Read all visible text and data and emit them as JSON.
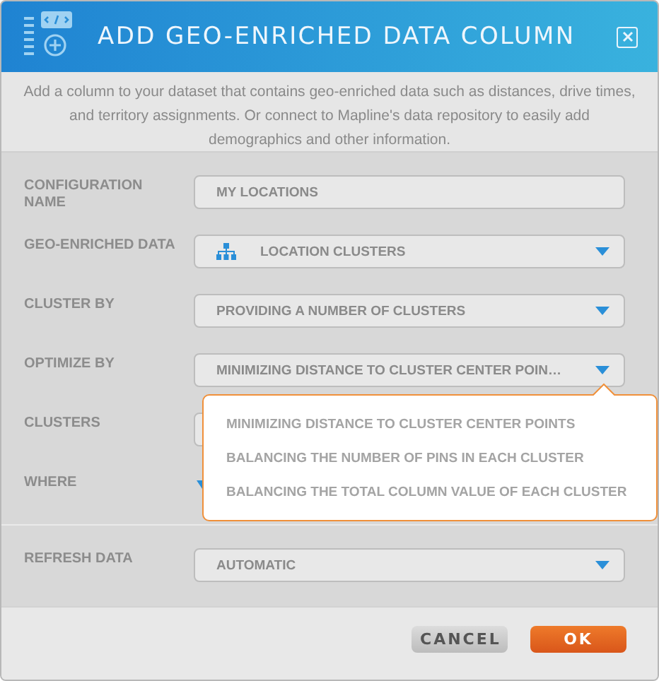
{
  "dialog": {
    "title": "ADD GEO-ENRICHED DATA COLUMN",
    "description": "Add a column to your dataset that contains geo-enriched data such as distances, drive times, and territory assignments. Or connect to Mapline's data repository to easily add demographics and other information."
  },
  "fields": [
    {
      "kind": "text",
      "label": "CONFIGURATION NAME",
      "value": "MY LOCATIONS"
    },
    {
      "kind": "source",
      "label": "GEO-ENRICHED DATA",
      "value": "LOCATION CLUSTERS"
    },
    {
      "kind": "select",
      "label": "CLUSTER BY",
      "value": "PROVIDING A NUMBER OF CLUSTERS"
    },
    {
      "kind": "select",
      "label": "OPTIMIZE BY",
      "value": "MINIMIZING DISTANCE TO CLUSTER CENTER POIN…",
      "expanded": true,
      "options": [
        "MINIMIZING DISTANCE TO CLUSTER CENTER POINTS",
        "BALANCING THE NUMBER OF PINS IN EACH CLUSTER",
        "BALANCING THE TOTAL COLUMN VALUE OF EACH CLUSTER"
      ]
    },
    {
      "kind": "text",
      "label": "CLUSTERS"
    },
    {
      "kind": "toggle",
      "label": "WHERE"
    }
  ],
  "refresh": {
    "label": "REFRESH DATA",
    "value": "AUTOMATIC"
  },
  "buttons": [
    {
      "label": "CANCEL",
      "kind": "secondary"
    },
    {
      "label": "OK",
      "kind": "primary"
    }
  ]
}
